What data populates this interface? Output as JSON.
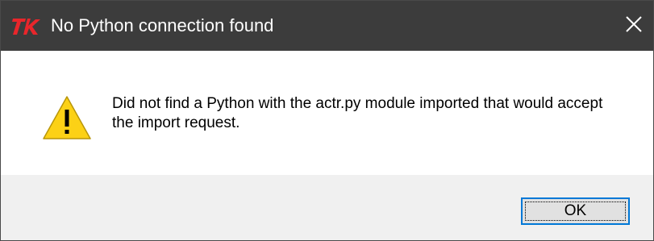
{
  "window": {
    "title": "No Python connection found",
    "app_icon": "tk-feather-icon",
    "close_icon": "close-icon"
  },
  "dialog": {
    "icon": "warning-icon",
    "message": "Did not find a Python with the actr.py module imported that would accept the import request."
  },
  "buttons": {
    "ok_label": "OK"
  },
  "colors": {
    "titlebar": "#3c3c3c",
    "footer": "#f0f0f0",
    "warning_yellow": "#fcd116",
    "focus_border": "#0078d7",
    "app_icon_red": "#e8262b"
  }
}
